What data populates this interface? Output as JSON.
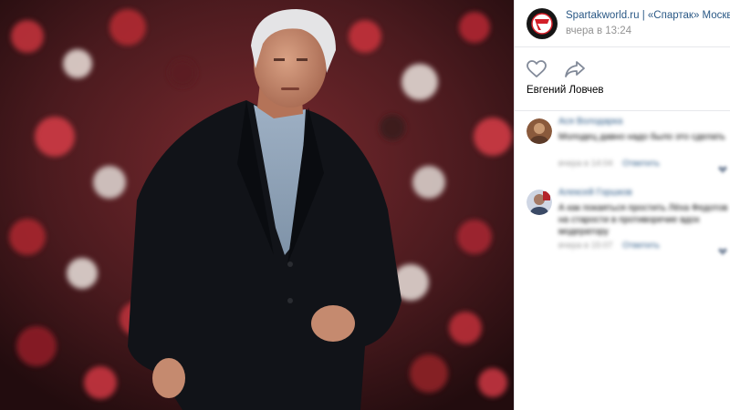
{
  "post": {
    "group_name": "Spartakworld.ru | «Спартак» Москва",
    "time": "вчера в 13:24",
    "caption": "Евгений Ловчев"
  },
  "icons": {
    "like": "heart-icon",
    "share": "share-arrow-icon"
  },
  "colors": {
    "link": "#2a5885",
    "meta": "#939393",
    "panel_bg": "#ffffff",
    "stadium_red": "#b3242b"
  },
  "comments": [
    {
      "author": "Ася Володарка",
      "text": "Молодец давно надо было это сделать",
      "date": "вчера в 14:04",
      "reply": "Ответить"
    },
    {
      "author": "Алексей Горшков",
      "text": "А как покаяться простить Лёха Федотов на старости в противоречие вдох модератору",
      "date": "вчера в 15:07",
      "reply": "Ответить"
    }
  ]
}
